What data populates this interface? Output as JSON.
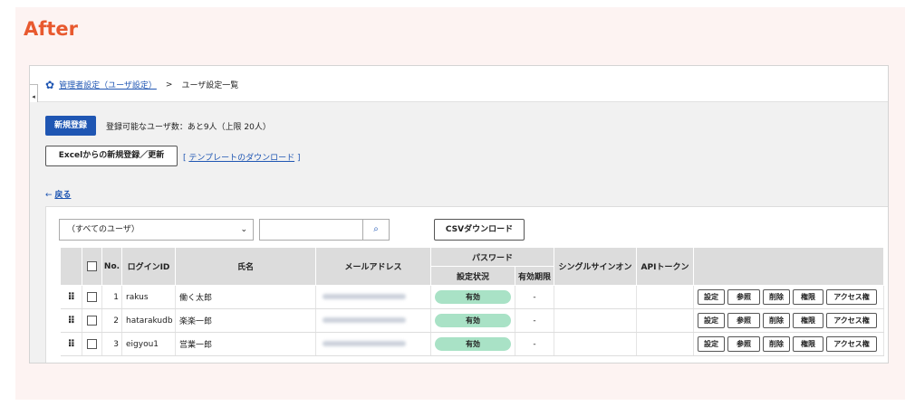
{
  "header": {
    "after_label": "After"
  },
  "breadcrumb": {
    "parent": "管理者設定（ユーザ設定）",
    "separator": ">",
    "current": "ユーザ設定一覧"
  },
  "toolbar": {
    "new_button": "新規登録",
    "registration_info": "登録可能なユーザ数：あと9人（上限 20人）",
    "excel_button": "Excelからの新規登録／更新",
    "template_open": "[",
    "template_link": "テンプレートのダウンロード",
    "template_close": "]",
    "back_arrow": "←",
    "back_link": "戻る"
  },
  "filter": {
    "selected_option": "（すべてのユーザ）",
    "search_placeholder": "",
    "csv_button": "CSVダウンロード"
  },
  "table": {
    "headers": {
      "no": "No.",
      "login_id": "ログインID",
      "name": "氏名",
      "email": "メールアドレス",
      "password": "パスワード",
      "password_status": "設定状況",
      "password_expiry": "有効期限",
      "sso": "シングルサインオン",
      "api_token": "APIトークン"
    },
    "rows": [
      {
        "no": "1",
        "login_id": "rakus",
        "name": "働く太郎",
        "status": "有効",
        "expiry": "-"
      },
      {
        "no": "2",
        "login_id": "hatarakudb",
        "name": "楽楽一郎",
        "status": "有効",
        "expiry": "-"
      },
      {
        "no": "3",
        "login_id": "eigyou1",
        "name": "営業一郎",
        "status": "有効",
        "expiry": "-"
      }
    ],
    "actions": {
      "settings": "設定",
      "view": "参照",
      "delete": "削除",
      "permission": "権限",
      "access": "アクセス権"
    }
  },
  "icons": {
    "breadcrumb": "gear-icon",
    "search": "search-icon",
    "drag": "drag-handle-icon",
    "dropdown": "chevron-down-icon"
  },
  "colors": {
    "accent": "#1f56b3",
    "after_label": "#e8592f",
    "status_pill": "#a9e2c6"
  }
}
